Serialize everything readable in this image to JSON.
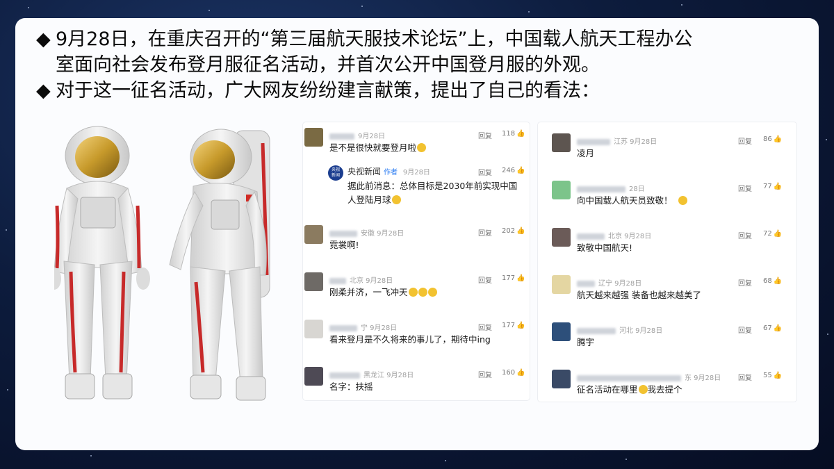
{
  "bullet": "◆",
  "headline": {
    "line1": "9月28日，在重庆召开的“第三届航天服技术论坛”上，中国载人航天工程办公",
    "line2": "室面向社会发布登月服征名活动，并首次公开中国登月服的外观。",
    "line3": "对于这一征名活动，广大网友纷纷建言献策，提出了自己的看法："
  },
  "reply_label": "回复",
  "left_comments": [
    {
      "meta": "9月28日",
      "likes": "118",
      "text": "是不是很快就要登月啦",
      "avatar": "#7a6a43"
    },
    {
      "meta": "安徽 9月28日",
      "likes": "202",
      "text": "霓裳啊!",
      "avatar": "#8b7b60"
    },
    {
      "meta": "北京 9月28日",
      "likes": "177",
      "text": "刚柔并济，一飞冲天",
      "avatar": "#6e6a66"
    },
    {
      "meta": "宁 9月28日",
      "likes": "177",
      "text": "看来登月是不久将来的事儿了，期待中ing",
      "avatar": "#d8d6d2"
    },
    {
      "meta": "黑龙江 9月28日",
      "likes": "160",
      "text": "名字：扶摇",
      "avatar": "#4e4a55"
    }
  ],
  "official_reply": {
    "name": "央视新闻",
    "badge": "作者",
    "date": "9月28日",
    "likes": "246",
    "line1": "据此前消息：总体目标是2030年前实现中国",
    "line2": "人登陆月球",
    "logo_line1": "央视",
    "logo_line2": "新闻"
  },
  "right_comments": [
    {
      "meta": "江苏 9月28日",
      "likes": "86",
      "text": "凌月",
      "avatar": "#5d5550"
    },
    {
      "meta": "28日",
      "likes": "77",
      "text": "向中国载人航天员致敬！",
      "avatar": "#7cc48a"
    },
    {
      "meta": "北京 9月28日",
      "likes": "72",
      "text": "致敬中国航天!",
      "avatar": "#6b5b58"
    },
    {
      "meta": "辽宁 9月28日",
      "likes": "68",
      "text": "航天越来越强 装备也越来越美了",
      "avatar": "#e4d6a2"
    },
    {
      "meta": "河北 9月28日",
      "likes": "67",
      "text": "腾宇",
      "avatar": "#2d4f7a"
    },
    {
      "meta": "东 9月28日",
      "likes": "55",
      "text": "征名活动在哪里",
      "text2": "我去提个",
      "avatar": "#3a4a66"
    }
  ],
  "colors": {
    "accent_red": "#c72a2a",
    "gold": "#c79a2b",
    "suit": "#e9e9e9"
  }
}
